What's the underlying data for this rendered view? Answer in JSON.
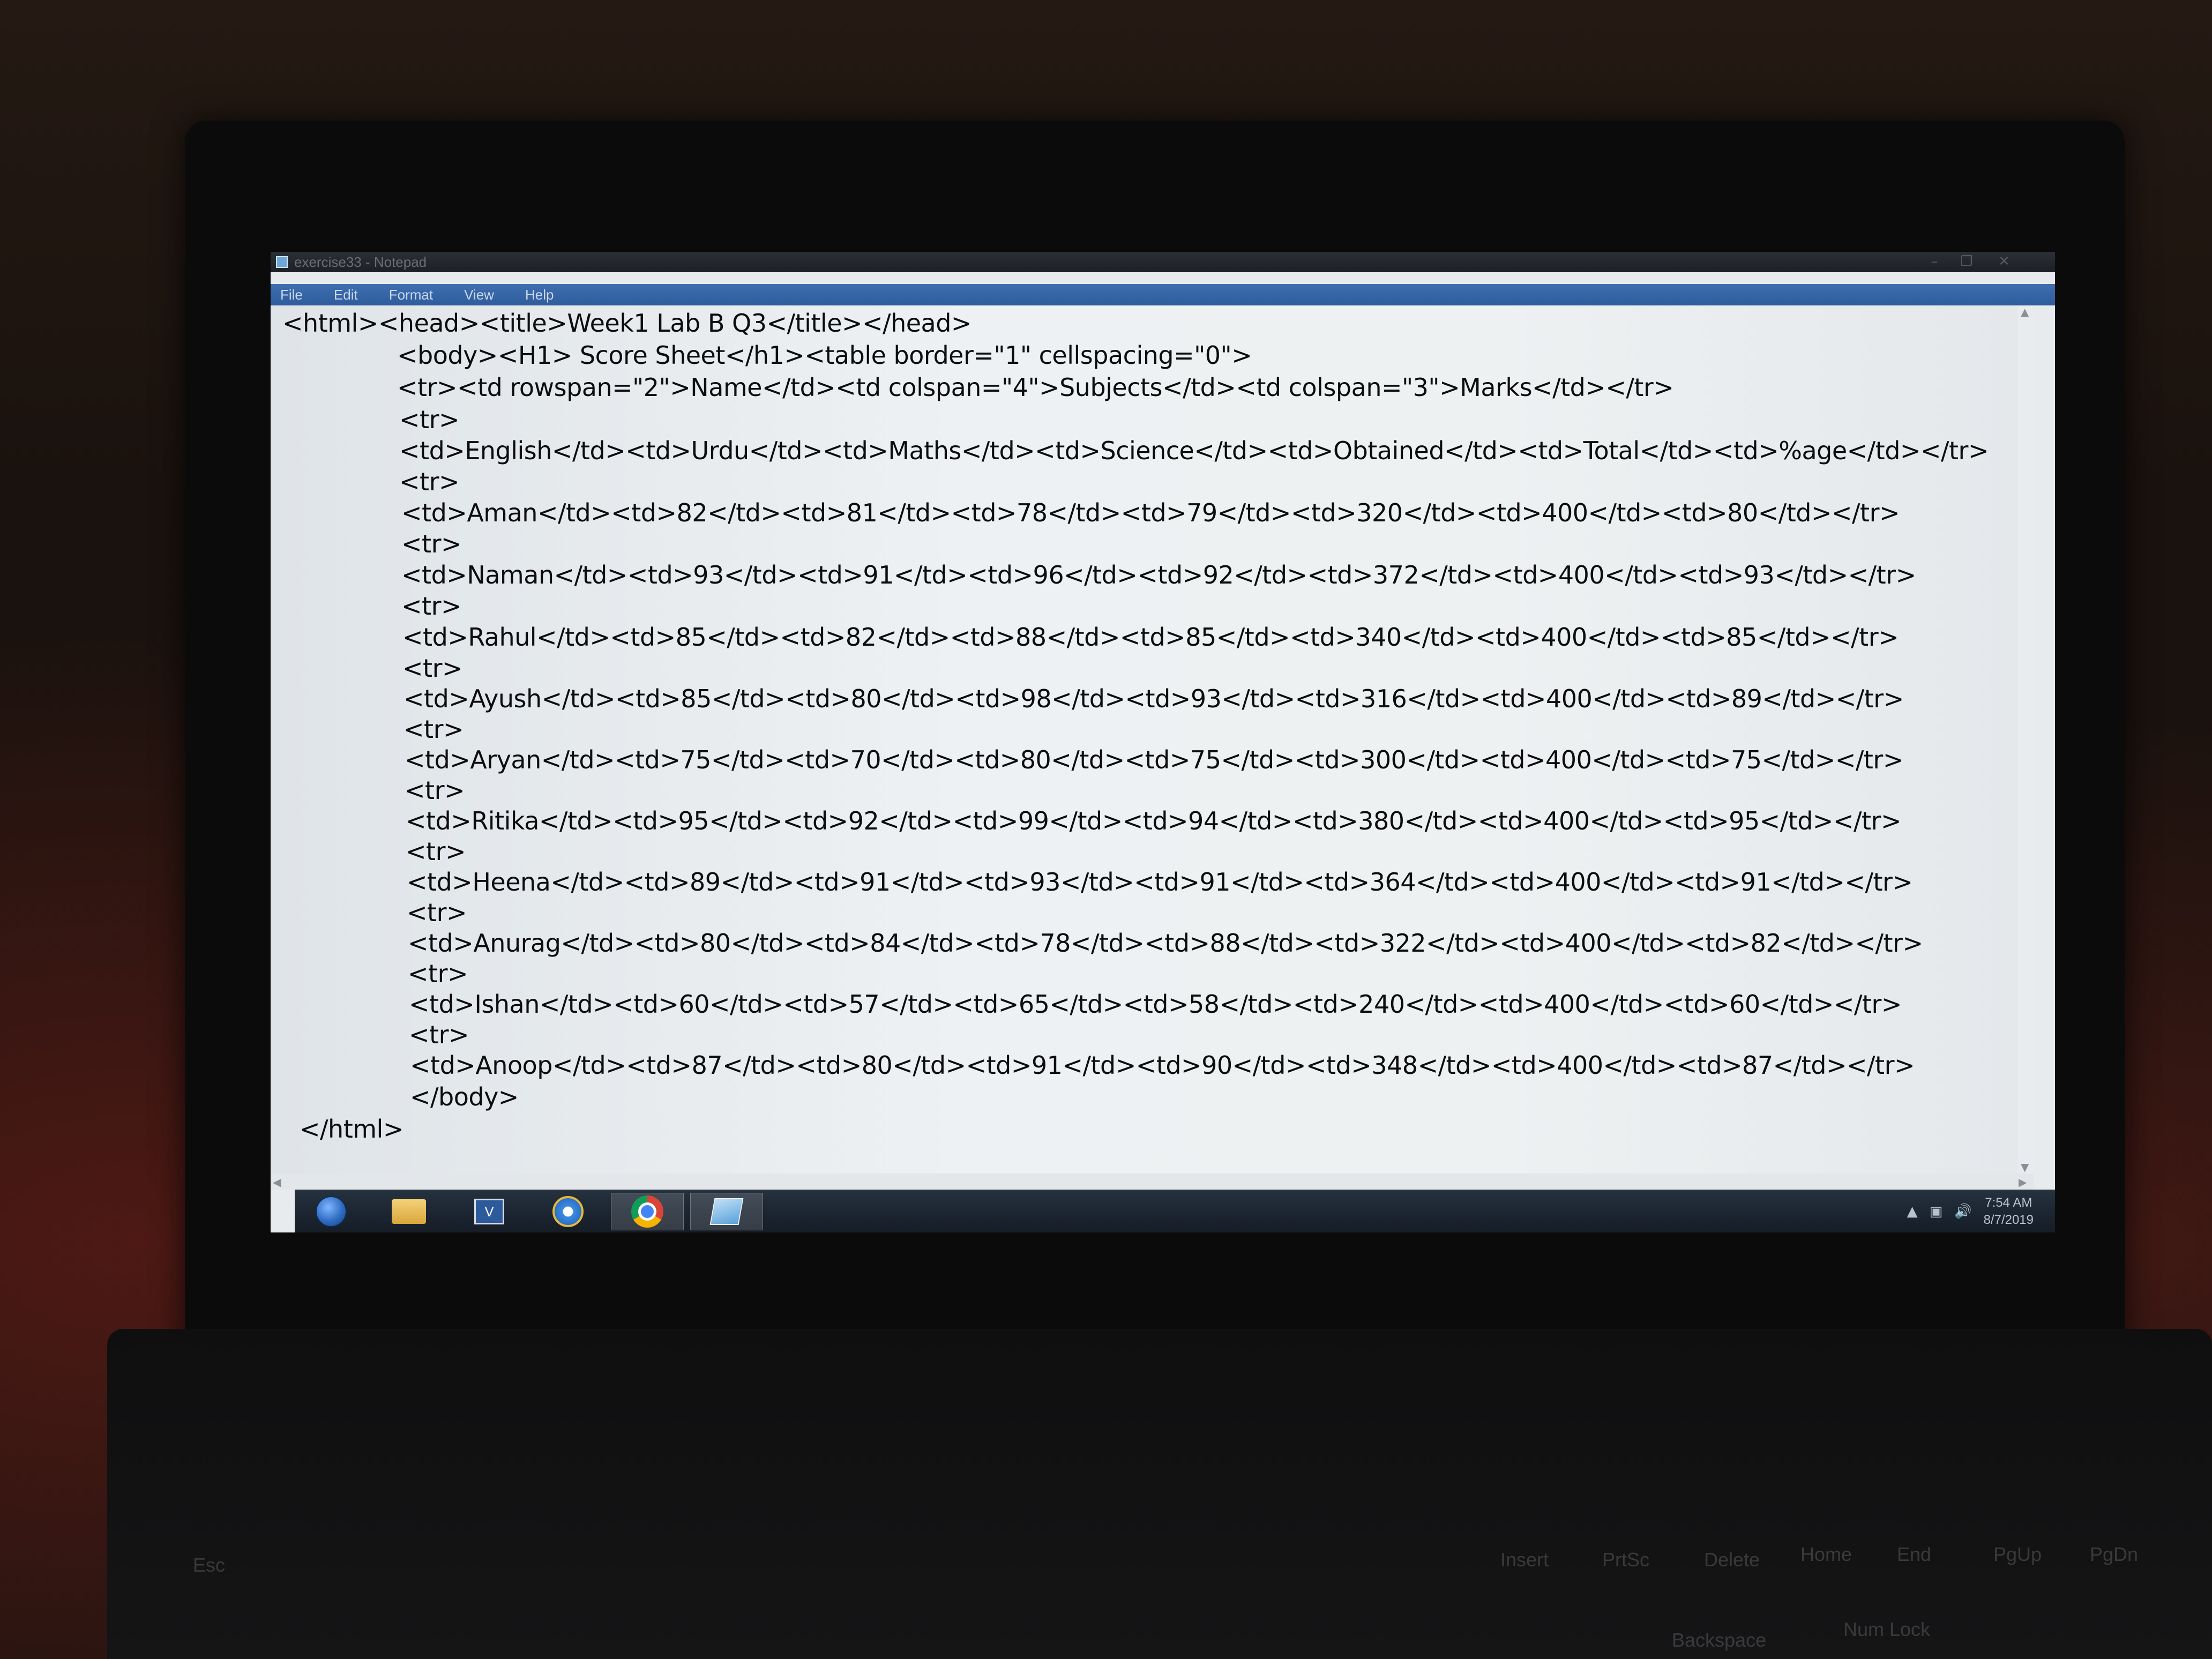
{
  "window": {
    "title": "exercise33 - Notepad",
    "controls": {
      "minimize": "–",
      "maximize": "❐",
      "close": "✕"
    }
  },
  "menu": [
    "File",
    "Edit",
    "Format",
    "View",
    "Help"
  ],
  "editor": {
    "lines": [
      "<html><head><title>Week1 Lab B Q3</title></head>",
      "<body><H1> Score Sheet</h1><table border=\"1\" cellspacing=\"0\">",
      "<tr><td rowspan=\"2\">Name</td><td colspan=\"4\">Subjects</td><td colspan=\"3\">Marks</td></tr>",
      "<tr>",
      "<td>English</td><td>Urdu</td><td>Maths</td><td>Science</td><td>Obtained</td><td>Total</td><td>%age</td></tr>",
      "<tr>",
      "<td>Aman</td><td>82</td><td>81</td><td>78</td><td>79</td><td>320</td><td>400</td><td>80</td></tr>",
      "<tr>",
      "<td>Naman</td><td>93</td><td>91</td><td>96</td><td>92</td><td>372</td><td>400</td><td>93</td></tr>",
      "<tr>",
      "<td>Rahul</td><td>85</td><td>82</td><td>88</td><td>85</td><td>340</td><td>400</td><td>85</td></tr>",
      "<tr>",
      "<td>Ayush</td><td>85</td><td>80</td><td>98</td><td>93</td><td>316</td><td>400</td><td>89</td></tr>",
      "<tr>",
      "<td>Aryan</td><td>75</td><td>70</td><td>80</td><td>75</td><td>300</td><td>400</td><td>75</td></tr>",
      "<tr>",
      "<td>Ritika</td><td>95</td><td>92</td><td>99</td><td>94</td><td>380</td><td>400</td><td>95</td></tr>",
      "<tr>",
      "<td>Heena</td><td>89</td><td>91</td><td>93</td><td>91</td><td>364</td><td>400</td><td>91</td></tr>",
      "<tr>",
      "<td>Anurag</td><td>80</td><td>84</td><td>78</td><td>88</td><td>322</td><td>400</td><td>82</td></tr>",
      "<tr>",
      "<td>Ishan</td><td>60</td><td>57</td><td>65</td><td>58</td><td>240</td><td>400</td><td>60</td></tr>",
      "<tr>",
      "<td>Anoop</td><td>87</td><td>80</td><td>91</td><td>90</td><td>348</td><td>400</td><td>87</td></tr>",
      "</body>",
      "</html>"
    ]
  },
  "taskbar": {
    "vb_label": "V",
    "tray": {
      "arrow": "▲",
      "network": "▣",
      "volume": "🔊"
    },
    "clock_time": "7:54 AM",
    "clock_date": "8/7/2019"
  },
  "keyboard": [
    "Esc",
    "Insert",
    "PrtSc",
    "Delete",
    "Home",
    "End",
    "PgUp",
    "PgDn",
    "Backspace",
    "Num Lock"
  ]
}
